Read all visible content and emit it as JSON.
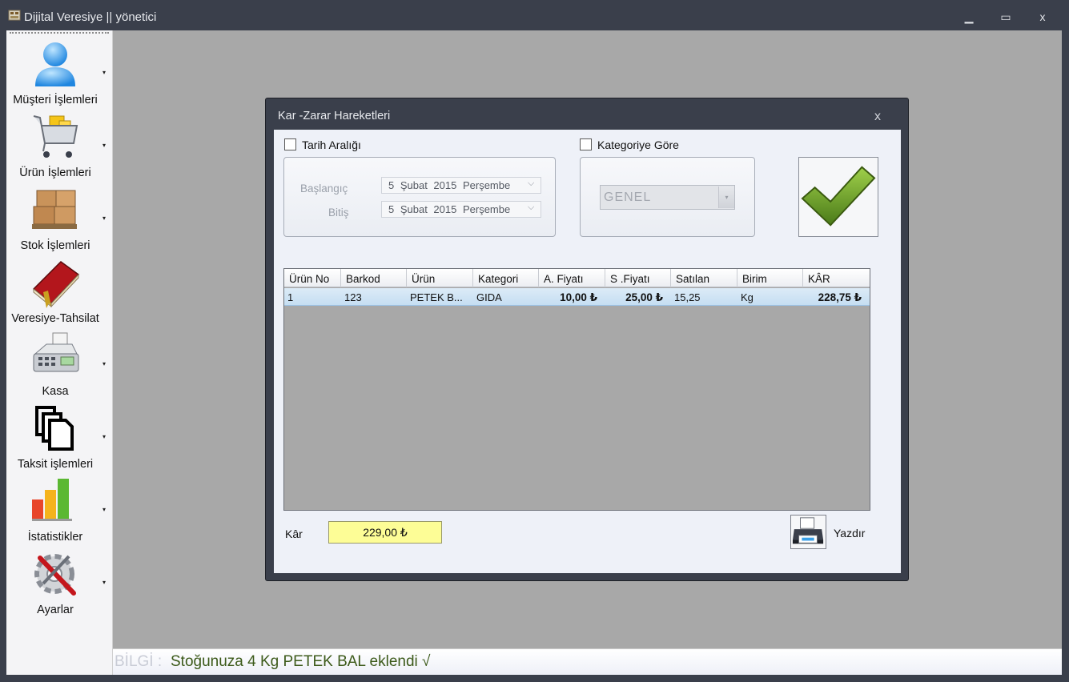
{
  "window": {
    "title": "Dijital Veresiye  ||  yönetici",
    "minimize_glyph": "▁",
    "maximize_glyph": "▭",
    "close_glyph": "x"
  },
  "sidebar": {
    "items": [
      {
        "label": "Müşteri İşlemleri",
        "icon": "user-icon"
      },
      {
        "label": "Ürün İşlemleri",
        "icon": "shopping-cart-icon"
      },
      {
        "label": "Stok İşlemleri",
        "icon": "boxes-icon"
      },
      {
        "label": "Veresiye-Tahsilat",
        "icon": "ledger-book-icon"
      },
      {
        "label": "Kasa",
        "icon": "cash-register-icon"
      },
      {
        "label": "Taksit işlemleri",
        "icon": "documents-icon"
      },
      {
        "label": "İstatistikler",
        "icon": "bar-chart-icon"
      },
      {
        "label": "Ayarlar",
        "icon": "settings-tools-icon"
      }
    ],
    "arrow_glyph": "▾"
  },
  "dialog": {
    "title": "Kar -Zarar Hareketleri",
    "close_glyph": "x",
    "date_range": {
      "checkbox_label": "Tarih Aralığı",
      "start_label": "Başlangıç",
      "end_label": "Bitiş",
      "start_value": "5 Şubat 2015 Perşembe",
      "end_value": "5 Şubat 2015 Perşembe",
      "arrow_glyph": "⌵"
    },
    "category": {
      "checkbox_label": "Kategoriye Göre",
      "selected": "GENEL",
      "arrow_glyph": "▾"
    },
    "table": {
      "columns": [
        "Ürün No",
        "Barkod",
        "Ürün",
        "Kategori",
        "A. Fiyatı",
        "S .Fiyatı",
        "Satılan",
        "Birim",
        "KÂR"
      ],
      "rows": [
        [
          "1",
          "123",
          "PETEK B...",
          "GIDA",
          "10,00 ₺",
          "25,00 ₺",
          "15,25",
          "Kg",
          "228,75 ₺"
        ]
      ]
    },
    "total": {
      "label": "Kâr",
      "value": "229,00 ₺"
    },
    "print_label": "Yazdır"
  },
  "status": {
    "prefix": "BİLGİ :",
    "message": "Stoğunuza 4 Kg PETEK BAL eklendi  √"
  },
  "colors": {
    "chrome": "#3a3f4b",
    "workspace": "#a8a8a8",
    "total_highlight": "#fdfd96",
    "status_text": "#3c5a1a",
    "confirm_check": "#6a9b2a"
  }
}
